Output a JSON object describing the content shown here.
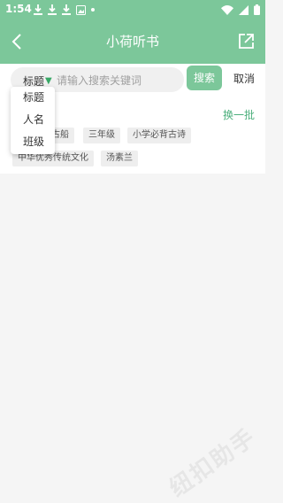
{
  "status_bar": {
    "time": "1:54",
    "left_icons": [
      "download-icon",
      "download-icon",
      "download-icon",
      "image-icon",
      "dot-icon"
    ],
    "right_icons": [
      "wifi-icon",
      "signal-icon",
      "battery-icon"
    ]
  },
  "app_bar": {
    "title": "小荷听书",
    "back_icon": "back-arrow-icon",
    "share_icon": "share-icon"
  },
  "search": {
    "type_label": "标题",
    "placeholder": "请输入搜索关键词",
    "value": "",
    "search_button": "搜索",
    "cancel_button": "取消"
  },
  "dropdown": {
    "options": [
      "标题",
      "人名",
      "班级"
    ]
  },
  "hot": {
    "refresh_label": "换一批",
    "tags": [
      "古船",
      "三年级",
      "小学必背古诗",
      "中华优秀传统文化",
      "汤素兰"
    ]
  },
  "watermark": "纽扣助手",
  "colors": {
    "brand_green": "#7cc79a",
    "accent_green": "#4caf7c",
    "arrow_green": "#37a866",
    "page_bg": "#f5f5f5"
  }
}
